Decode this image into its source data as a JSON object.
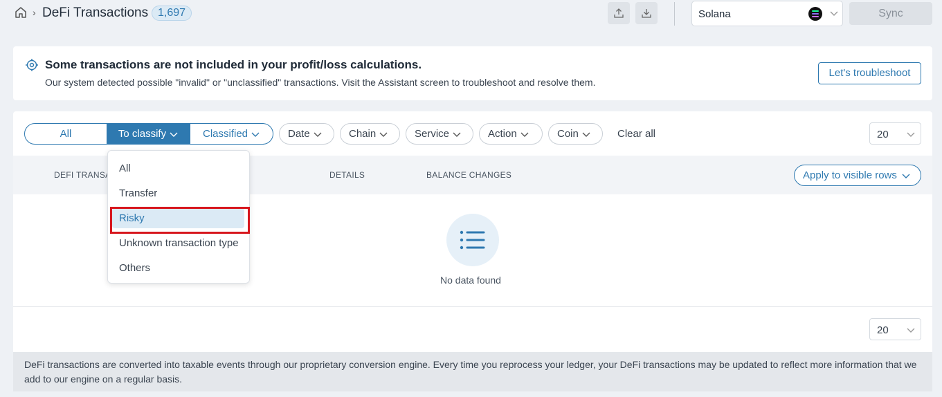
{
  "header": {
    "title": "DeFi Transactions",
    "count": "1,697",
    "chain_selected": "Solana",
    "sync_label": "Sync"
  },
  "alert": {
    "title": "Some transactions are not included in your profit/loss calculations.",
    "text": "Our system detected possible \"invalid\" or \"unclassified\" transactions. Visit the Assistant screen to troubleshoot and resolve them.",
    "button_label": "Let's troubleshoot"
  },
  "filters": {
    "segments": [
      "All",
      "To classify",
      "Classified"
    ],
    "active_segment": "To classify",
    "dropdowns": [
      "Date",
      "Chain",
      "Service",
      "Action",
      "Coin"
    ],
    "clear_all": "Clear all",
    "per_page": "20"
  },
  "table": {
    "columns": [
      "DEFI TRANSA",
      "DETAILS",
      "BALANCE CHANGES"
    ],
    "apply_label": "Apply to visible rows",
    "empty_text": "No data found"
  },
  "pagination": {
    "per_page": "20"
  },
  "dropdown_menu": {
    "items": [
      "All",
      "Transfer",
      "Risky",
      "Unknown transaction type",
      "Others"
    ],
    "highlighted": "Risky"
  },
  "footnote": "DeFi transactions are converted into taxable events through our proprietary conversion engine. Every time you reprocess your ledger, your DeFi transactions may be updated to reflect more information that we add to our engine on a regular basis.",
  "colors": {
    "accent": "#2e79b0",
    "highlight": "#dbeaf5",
    "focus_outline": "#d7171e"
  },
  "icons": [
    "home-icon",
    "upload-icon",
    "download-icon",
    "solana-logo",
    "chevron-down-icon",
    "target-icon",
    "list-icon"
  ]
}
